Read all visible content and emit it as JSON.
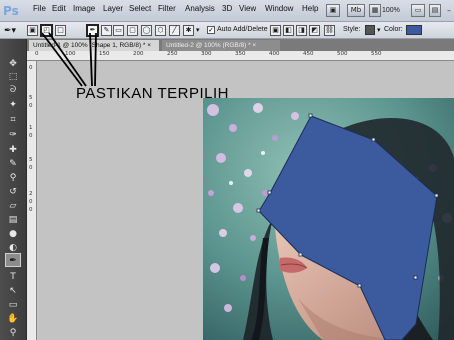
{
  "menubar": {
    "logo": "Ps",
    "items": [
      "File",
      "Edit",
      "Image",
      "Layer",
      "Select",
      "Filter",
      "Analysis",
      "3D",
      "View",
      "Window",
      "Help"
    ],
    "zoom": "100%",
    "window_controls": [
      "–",
      "□",
      "×"
    ]
  },
  "options_bar": {
    "auto_add_delete_label": "Auto Add/Delete",
    "style_label": "Style:",
    "color_label": "Color:",
    "color_value": "#3c5a9e"
  },
  "tabs": [
    {
      "label": "Untitled-1 @ 100% (Shape 1, RGB/8) * ×",
      "active": true
    },
    {
      "label": "Untitled-2 @ 100% (RGB/8) * ×",
      "active": false
    }
  ],
  "rulers": {
    "top": [
      "0",
      "100",
      "150",
      "200",
      "250",
      "300",
      "350",
      "400",
      "450",
      "500",
      "550"
    ],
    "left": [
      "0",
      "5",
      "0",
      "1",
      "0",
      "5",
      "0",
      "2",
      "0",
      "0"
    ]
  },
  "annotation": {
    "text": "PASTIKAN TERPILIH"
  },
  "colors": {
    "shape_fill": "#3c5a9e",
    "toolbox_bg": "#454545",
    "canvas_bg": "#c3c3c3"
  },
  "toolbox": {
    "tools": [
      "move-tool",
      "marquee-tool",
      "lasso-tool",
      "quick-select-tool",
      "crop-tool",
      "eyedropper-tool",
      "healing-tool",
      "brush-tool",
      "clone-stamp-tool",
      "history-brush-tool",
      "eraser-tool",
      "gradient-tool",
      "blur-tool",
      "dodge-tool",
      "pen-tool",
      "type-tool",
      "path-select-tool",
      "shape-tool",
      "hand-tool",
      "zoom-tool"
    ],
    "selected": "pen-tool"
  }
}
